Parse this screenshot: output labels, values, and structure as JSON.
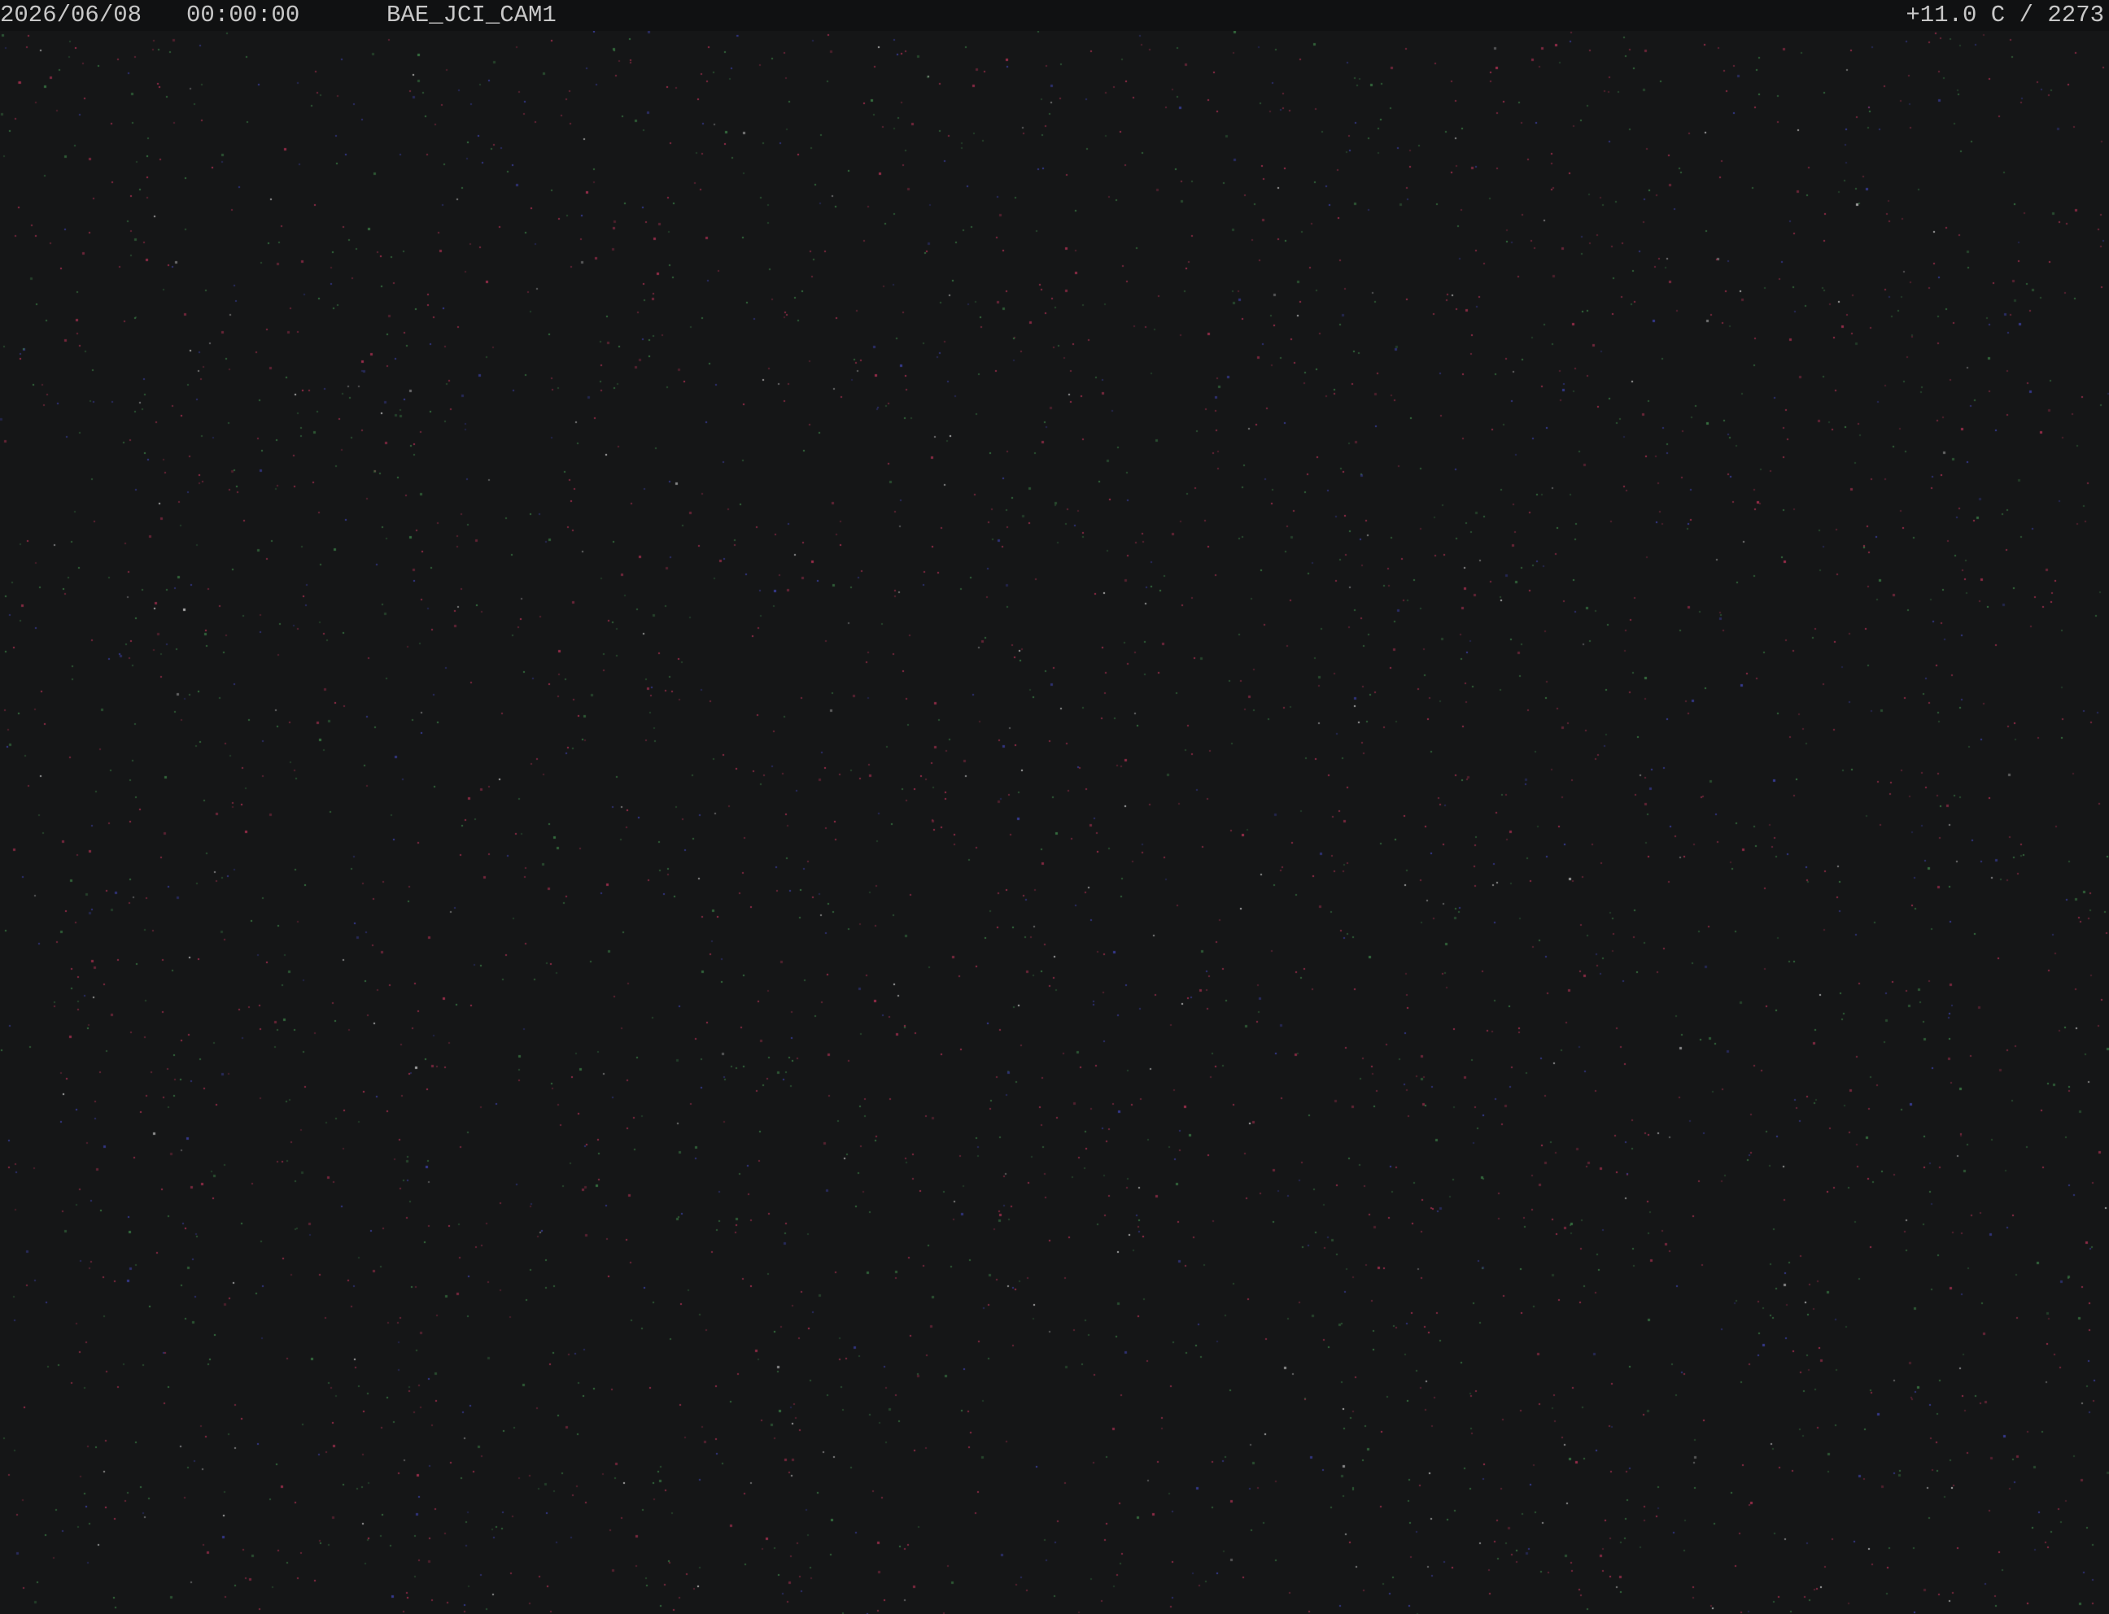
{
  "overlay": {
    "date": "2026/06/08",
    "time": "00:00:00",
    "camera_name": "BAE_JCI_CAM1",
    "temperature_exposure": "+11.0 C / 2273"
  },
  "image": {
    "scene": "night-sky",
    "background_color": "#151617",
    "noise_colors": [
      "#a83050",
      "#3a7a44",
      "#3b3fa0",
      "#c0c0c0"
    ]
  }
}
